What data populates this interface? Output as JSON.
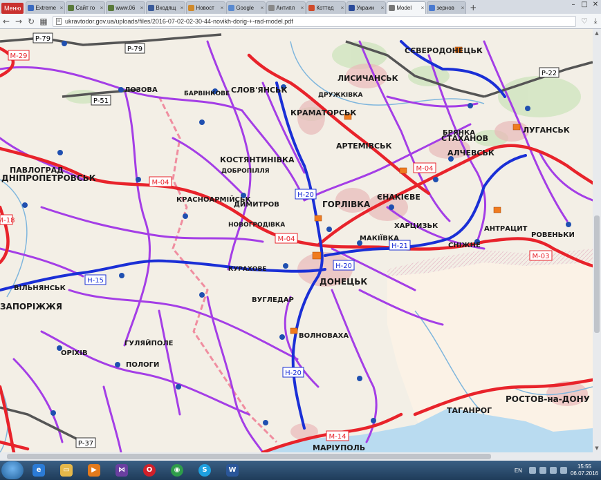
{
  "tabs": {
    "menu": "Меню",
    "items": [
      {
        "title": "Extreme",
        "color": "#3a6ac0"
      },
      {
        "title": "Сайт го",
        "color": "#5a7a3a"
      },
      {
        "title": "www.06",
        "color": "#5a7a3a"
      },
      {
        "title": "Входящ",
        "color": "#3a5a9a"
      },
      {
        "title": "Новост",
        "color": "#d08a2a"
      },
      {
        "title": "Google",
        "color": "#5a8ad0"
      },
      {
        "title": "Антипл",
        "color": "#888888"
      },
      {
        "title": "Коттед",
        "color": "#d04a2a"
      },
      {
        "title": "Украин",
        "color": "#2a4a9a"
      },
      {
        "title": "Model",
        "color": "#777777"
      },
      {
        "title": "зернов",
        "color": "#4a7ad0"
      }
    ],
    "active_index": 9
  },
  "address": {
    "url": "ukravtodor.gov.ua/uploads/files/2016-07-02-02-30-44-novikh-dorig-+-rad-model.pdf"
  },
  "map": {
    "cities": [
      {
        "name": "ЛОЗОВА"
      },
      {
        "name": "СЛОВ'ЯНСЬК"
      },
      {
        "name": "КРАМАТОРСЬК"
      },
      {
        "name": "ЛИСИЧАНСЬК"
      },
      {
        "name": "СЄВЕРОДОНЕЦЬК"
      },
      {
        "name": "ЛУГАНСЬК"
      },
      {
        "name": "СТАХАНОВ"
      },
      {
        "name": "АЛЧЕВСЬК"
      },
      {
        "name": "АРТЕМІВСЬК"
      },
      {
        "name": "КОСТЯНТИНІВКА"
      },
      {
        "name": "ГОРЛІВКА"
      },
      {
        "name": "ДИМИТРОВ"
      },
      {
        "name": "КРАСНОАРМІЙСЬК"
      },
      {
        "name": "ЄНАКІЄВЕ"
      },
      {
        "name": "ДОНЕЦЬК"
      },
      {
        "name": "МАКІЇВКА"
      },
      {
        "name": "ХАРЦИЗЬК"
      },
      {
        "name": "ДНІПРОПЕТРОВСЬК"
      },
      {
        "name": "ЗАПОРІЖЖЯ"
      },
      {
        "name": "МАРІУПОЛЬ"
      },
      {
        "name": "ТАГАНРОГ"
      },
      {
        "name": "РОСТОВ-на-ДОНУ"
      },
      {
        "name": "ВУГЛЕДАР"
      },
      {
        "name": "ВОЛНОВАХА"
      },
      {
        "name": "ОРІХІВ"
      },
      {
        "name": "ПОЛОГИ"
      },
      {
        "name": "ГУЛЯЙПОЛЕ"
      },
      {
        "name": "БРЯНКА"
      },
      {
        "name": "АНТРАЦИТ"
      },
      {
        "name": "РОВЕНЬКИ"
      },
      {
        "name": "СНІЖНЕ"
      },
      {
        "name": "КУРАХОВЕ"
      },
      {
        "name": "НОВОГРОДІВКА"
      },
      {
        "name": "ДОБРОПІЛЛЯ"
      },
      {
        "name": "ВІЛЬНЯНСЬК"
      },
      {
        "name": "ДРУЖКІВКА"
      },
      {
        "name": "ПАВЛОГРАД"
      },
      {
        "name": "БАРВІНКОВЕ"
      }
    ],
    "road_labels": [
      {
        "name": "P-79"
      },
      {
        "name": "M-29"
      },
      {
        "name": "P-51"
      },
      {
        "name": "P-22"
      },
      {
        "name": "M-04"
      },
      {
        "name": "H-20"
      },
      {
        "name": "H-21"
      },
      {
        "name": "M-03"
      },
      {
        "name": "H-15"
      },
      {
        "name": "M-14"
      },
      {
        "name": "P-37"
      },
      {
        "name": "M-18"
      }
    ],
    "colors": {
      "national": "#e8232b",
      "regional": "#a43ee6",
      "h_road": "#1a2fd6",
      "border": "#f08ea0",
      "water": "#9cc9e8",
      "sea": "#b9dbf0",
      "russia": "#fdf4e8"
    }
  },
  "taskbar": {
    "lang": "EN",
    "time": "15:55",
    "date": "06.07.2016"
  }
}
